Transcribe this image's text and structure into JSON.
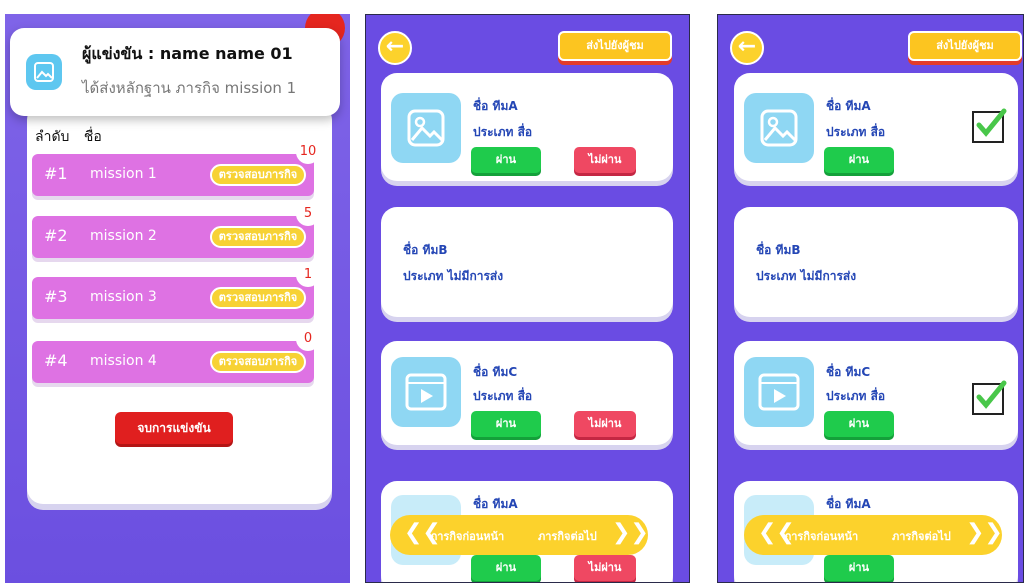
{
  "screen1": {
    "notification": {
      "title": "ผู้แข่งขัน : name name 01",
      "message": "ได้ส่งหลักฐาน ภารกิจ mission 1"
    },
    "header": {
      "rank_label": "ลำดับ",
      "name_label": "ชื่อ"
    },
    "missions": [
      {
        "rank": "#1",
        "name": "mission 1",
        "button": "ตรวจสอบภารกิจ",
        "count": "10"
      },
      {
        "rank": "#2",
        "name": "mission 2",
        "button": "ตรวจสอบภารกิจ",
        "count": "5"
      },
      {
        "rank": "#3",
        "name": "mission 3",
        "button": "ตรวจสอบภารกิจ",
        "count": "1"
      },
      {
        "rank": "#4",
        "name": "mission 4",
        "button": "ตรวจสอบภารกิจ",
        "count": "0"
      }
    ],
    "end_button": "จบการแข่งขัน"
  },
  "screen2": {
    "back_icon": "back-arrow-icon",
    "send_button": "ส่งไปยังผู้ชม",
    "cards": [
      {
        "name": "ชื่อ ทีมA",
        "type": "ประเภท สื่อ",
        "pass": "ผ่าน",
        "fail": "ไม่ผ่าน",
        "thumb": "image-icon"
      },
      {
        "name": "ชื่อ ทีมB",
        "type": "ประเภท ไม่มีการส่ง"
      },
      {
        "name": "ชื่อ ทีมC",
        "type": "ประเภท สื่อ",
        "pass": "ผ่าน",
        "fail": "ไม่ผ่าน",
        "thumb": "video-icon"
      },
      {
        "name": "ชื่อ ทีมA",
        "pass": "ผ่าน",
        "fail": "ไม่ผ่าน"
      }
    ],
    "nav": {
      "prev": "ภารกิจก่อนหน้า",
      "next": "ภารกิจต่อไป"
    }
  },
  "screen3": {
    "back_icon": "back-arrow-icon",
    "send_button": "ส่งไปยังผู้ชม",
    "cards": [
      {
        "name": "ชื่อ ทีมA",
        "type": "ประเภท สื่อ",
        "pass": "ผ่าน",
        "checked": true
      },
      {
        "name": "ชื่อ ทีมB",
        "type": "ประเภท ไม่มีการส่ง"
      },
      {
        "name": "ชื่อ ทีมC",
        "type": "ประเภท สื่อ",
        "pass": "ผ่าน",
        "checked": true
      },
      {
        "name": "ชื่อ ทีมA",
        "pass": "ผ่าน"
      }
    ],
    "nav": {
      "prev": "ภารกิจก่อนหน้า",
      "next": "ภารกิจต่อไป"
    }
  },
  "colors": {
    "background": "#6a4ce3",
    "mission_row": "#de72e3",
    "yellow": "#fcd22c",
    "pass_green": "#1fcb4c",
    "fail_red": "#ef4862",
    "team_text": "#2446b5"
  }
}
